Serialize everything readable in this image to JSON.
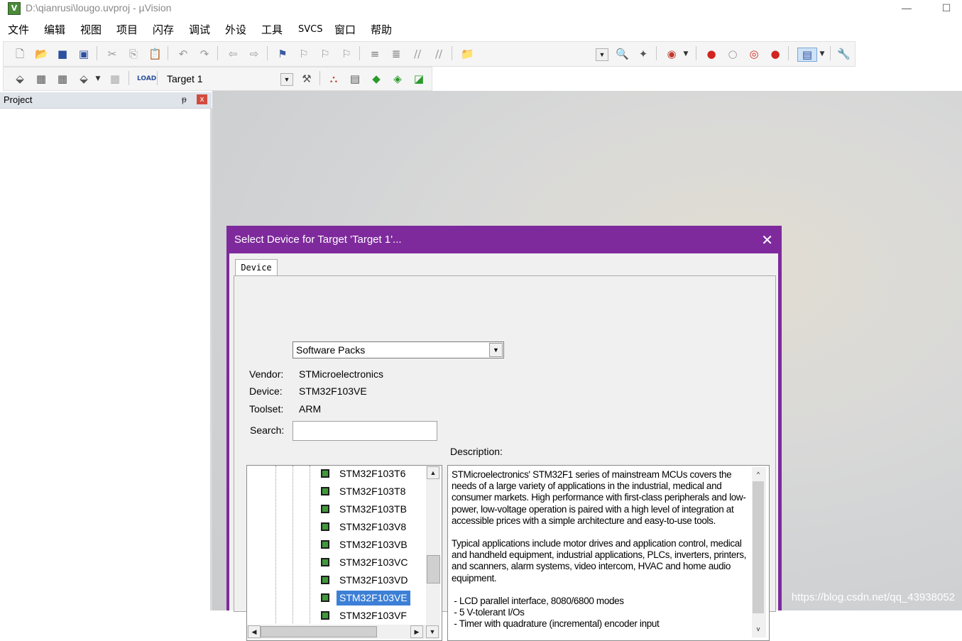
{
  "window": {
    "title": "D:\\qianrusi\\lougo.uvproj - µVision",
    "app_icon": "uvision-logo-icon",
    "minimize": "—",
    "maximize": "☐"
  },
  "menu": [
    "文件",
    "编辑",
    "视图",
    "项目",
    "闪存",
    "调试",
    "外设",
    "工具",
    "SVCS",
    "窗口",
    "帮助"
  ],
  "toolbar2": {
    "target": "Target 1"
  },
  "project_panel": {
    "title": "Project",
    "pin": "ᵽ",
    "close": "x"
  },
  "dialog": {
    "title": "Select Device for Target 'Target 1'...",
    "close": "✕",
    "tab": "Device",
    "pack_select": "Software Packs",
    "vendor_label": "Vendor:",
    "vendor": "STMicroelectronics",
    "device_label": "Device:",
    "device": "STM32F103VE",
    "toolset_label": "Toolset:",
    "toolset": "ARM",
    "search_label": "Search:",
    "search_value": "",
    "description_label": "Description:",
    "devices": [
      "STM32F103T6",
      "STM32F103T8",
      "STM32F103TB",
      "STM32F103V8",
      "STM32F103VB",
      "STM32F103VC",
      "STM32F103VD",
      "STM32F103VE",
      "STM32F103VF"
    ],
    "selected_device": "STM32F103VE",
    "description": [
      "STMicroelectronics' STM32F1 series of mainstream MCUs covers the needs of a large variety of applications in the industrial, medical and consumer markets. High performance with first-class peripherals and low-power, low-voltage operation is paired with a high level of integration at accessible prices with a simple architecture and easy-to-use tools.",
      "Typical applications include motor drives and application control, medical and handheld equipment, industrial applications, PLCs, inverters, printers, and scanners, alarm systems, video intercom, HVAC and home audio equipment.",
      " - LCD parallel interface, 8080/6800 modes\n - 5 V-tolerant I/Os\n - Timer with quadrature (incremental) encoder input"
    ]
  },
  "watermark": "https://blog.csdn.net/qq_43938052"
}
